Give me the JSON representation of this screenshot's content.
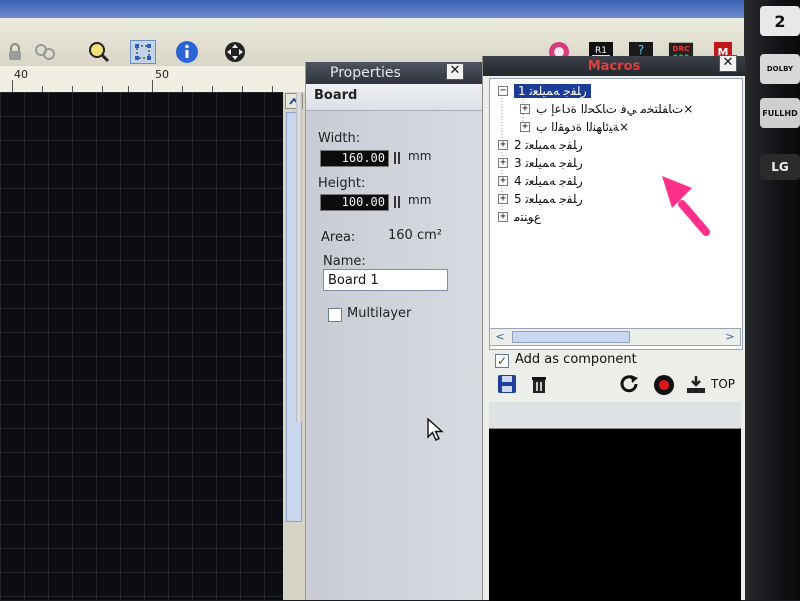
{
  "toolbar": {
    "icons": [
      "lock-icon",
      "layers-icon",
      "zoom-icon",
      "select-tool-icon",
      "info-icon",
      "move-icon",
      "record-icon",
      "r1-icon",
      "help-icon",
      "drc-icon",
      "macro-icon"
    ],
    "r1_label": "R1",
    "help_label": "?",
    "drc_label": "DRC",
    "macro_label": "M"
  },
  "ruler": {
    "labels": [
      "40",
      "50"
    ]
  },
  "properties": {
    "title": "Properties",
    "close": "✕",
    "section": "Board",
    "width_label": "Width:",
    "width_value": "160.00",
    "width_unit": "mm",
    "height_label": "Height:",
    "height_value": "100.00",
    "height_unit": "mm",
    "area_label": "Area:",
    "area_value": "160 cm²",
    "name_label": "Name:",
    "name_value": "Board 1",
    "multilayer_label": "Multilayer"
  },
  "macros": {
    "title": "Macros",
    "close": "✕",
    "tree": [
      {
        "label": "ﺭﻠﻔﺟ ﻪﻤﻴﻠﻌﺗ 1",
        "level": 0,
        "expanded": true,
        "selected": true
      },
      {
        "label": "ﺕﺎﻔﻠﺘﺨﻣ ﻲﻓ ﺕﺎﻜﺤﻟﺍ ﺓﺩﺎﻋﺇ ﺏ×",
        "level": 1,
        "expanded": false,
        "selected": false
      },
      {
        "label": "ﺔﻴﺋﺎﻬﻨﻟﺍ ﺓﺩﻮﻘﻟﺍ ﺏ×",
        "level": 1,
        "expanded": false,
        "selected": false
      },
      {
        "label": "ﺭﻠﻔﺟ ﻪﻤﻴﻠﻌﺗ 2",
        "level": 0,
        "expanded": false,
        "selected": false
      },
      {
        "label": "ﺭﻠﻔﺟ ﻪﻤﻴﻠﻌﺗ 3",
        "level": 0,
        "expanded": false,
        "selected": false
      },
      {
        "label": "ﺭﻠﻔﺟ ﻪﻤﻴﻠﻌﺗ 4",
        "level": 0,
        "expanded": false,
        "selected": false
      },
      {
        "label": "ﺭﻠﻔﺟ ﻪﻤﻴﻠﻌﺗ 5",
        "level": 0,
        "expanded": false,
        "selected": false
      },
      {
        "label": "ﻉﻮﻨﺘﻣ",
        "level": 0,
        "expanded": false,
        "selected": false
      }
    ],
    "add_component_label": "Add as component",
    "tool_icons": [
      "save-icon",
      "trash-icon",
      "refresh-icon",
      "record-icon",
      "import-icon"
    ],
    "top_label": "TOP"
  },
  "bezel": {
    "stickers": [
      "2",
      "DOLBY",
      "FULLHD",
      "LG"
    ]
  },
  "colors": {
    "accent": "#1c3d96",
    "annotation": "#ff2f8a",
    "macros_title": "#e04040"
  }
}
